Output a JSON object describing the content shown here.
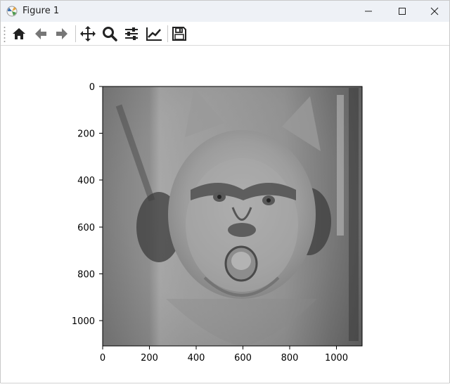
{
  "window": {
    "title": "Figure 1",
    "controls": [
      "minimize-icon",
      "maximize-icon",
      "close-icon"
    ]
  },
  "toolbar": {
    "buttons": [
      {
        "name": "home",
        "icon": "home-icon"
      },
      {
        "name": "back",
        "icon": "arrow-left-icon"
      },
      {
        "name": "forward",
        "icon": "arrow-right-icon"
      },
      {
        "name": "pan",
        "icon": "move-icon"
      },
      {
        "name": "zoom",
        "icon": "magnifier-icon"
      },
      {
        "name": "configure-subplots",
        "icon": "sliders-icon"
      },
      {
        "name": "edit-axis",
        "icon": "line-chart-icon"
      },
      {
        "name": "save",
        "icon": "floppy-disk-icon"
      }
    ]
  },
  "plot": {
    "image_description": "grayscale hybrid image of a cat face blended with a face",
    "x_ticks": [
      "0",
      "200",
      "400",
      "600",
      "800",
      "1000"
    ],
    "y_ticks": [
      "0",
      "200",
      "400",
      "600",
      "800",
      "1000"
    ],
    "x_range": [
      0,
      1110
    ],
    "y_range": [
      0,
      1110
    ]
  }
}
